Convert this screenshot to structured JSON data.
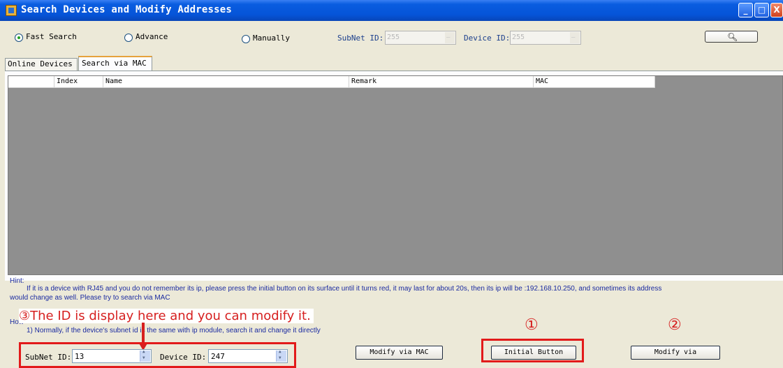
{
  "window": {
    "title": "Search Devices and Modify Addresses"
  },
  "search": {
    "fast": "Fast Search",
    "advance": "Advance",
    "manually": "Manually",
    "subnet_label": "SubNet ID:",
    "subnet_value": "255",
    "device_label": "Device ID:",
    "device_value": "255",
    "selected_mode": "Fast Search"
  },
  "tabs": {
    "online": "Online Devices",
    "mac": "Search via MAC"
  },
  "grid": {
    "columns": [
      "Index",
      "Name",
      "Remark",
      "MAC"
    ]
  },
  "hint": {
    "title": "Hint:",
    "line1": "If it is a device with RJ45 and you do not remember its ip, please press the initial button on its surface until it turns red, it may last for about 20s, then its ip will be :192.168.10.250, and sometimes its address",
    "line2": "would change as well. Please try to search via MAC",
    "how_title": "How",
    "how_line1": "1) Normally, if the device's subnet id is the same with ip module, search it and change it directly"
  },
  "bottom": {
    "subnet_label": "SubNet ID:",
    "subnet_value": "13",
    "device_label": "Device ID:",
    "device_value": "247",
    "modify_mac": "Modify via MAC",
    "initial": "Initial Button",
    "modify_via": "Modify via"
  },
  "annotations": {
    "step3_marker": "③",
    "step3_text": "The ID is display here and you can modify it.",
    "step1_marker": "①",
    "step2_marker": "②"
  },
  "colors": {
    "annotation": "#e21a1a",
    "titlebar": "#0554d8",
    "grid_bg": "#8f8f8f"
  }
}
